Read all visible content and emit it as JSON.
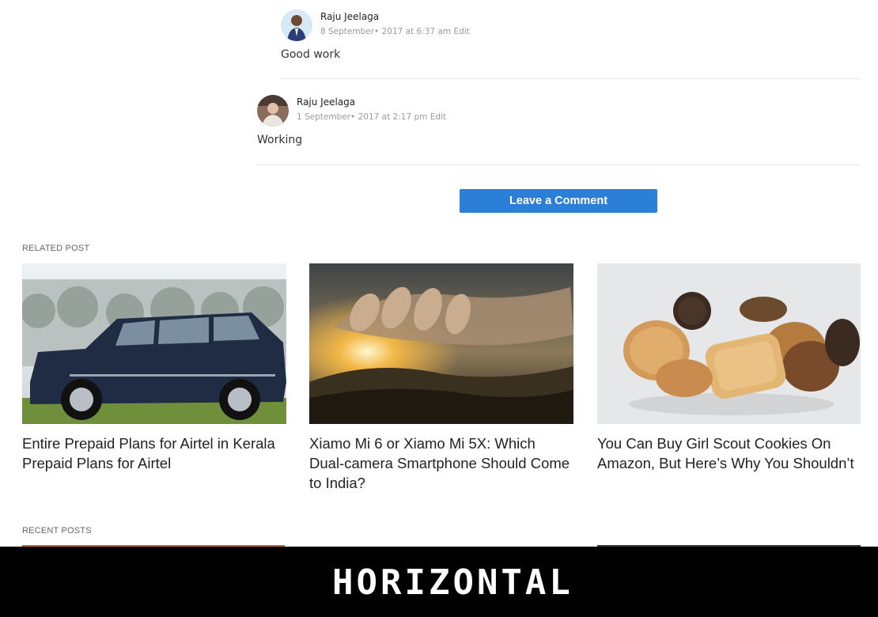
{
  "comments": [
    {
      "author": "Raju Jeelaga",
      "date": "8 September• 2017 at 6:37 am",
      "edit_label": "Edit",
      "body": "Good work"
    },
    {
      "author": "Raju Jeelaga",
      "date": "1 September• 2017 at 2:17 pm",
      "edit_label": "Edit",
      "body": "Working"
    }
  ],
  "leave_comment_label": "Leave a Comment",
  "related": {
    "label": "RELATED POST",
    "posts": [
      {
        "title": "Entire Prepaid Plans for Airtel in Kerala Prepaid Plans for Airtel",
        "image": "suv-car-photo"
      },
      {
        "title": "Xiamo Mi 6 or Xiamo Mi 5X: Which Dual-camera Smartphone Should Come to India?",
        "image": "hand-over-sunset-photo"
      },
      {
        "title": "You Can Buy Girl Scout Cookies On Amazon, But Here’s Why You Shouldn’t",
        "image": "cookies-photo"
      }
    ]
  },
  "recent": {
    "label": "RECENT POSTS"
  },
  "overlay_text": "HORIZONTAL",
  "colors": {
    "accent": "#2b7fd6",
    "banner": "#000000"
  }
}
